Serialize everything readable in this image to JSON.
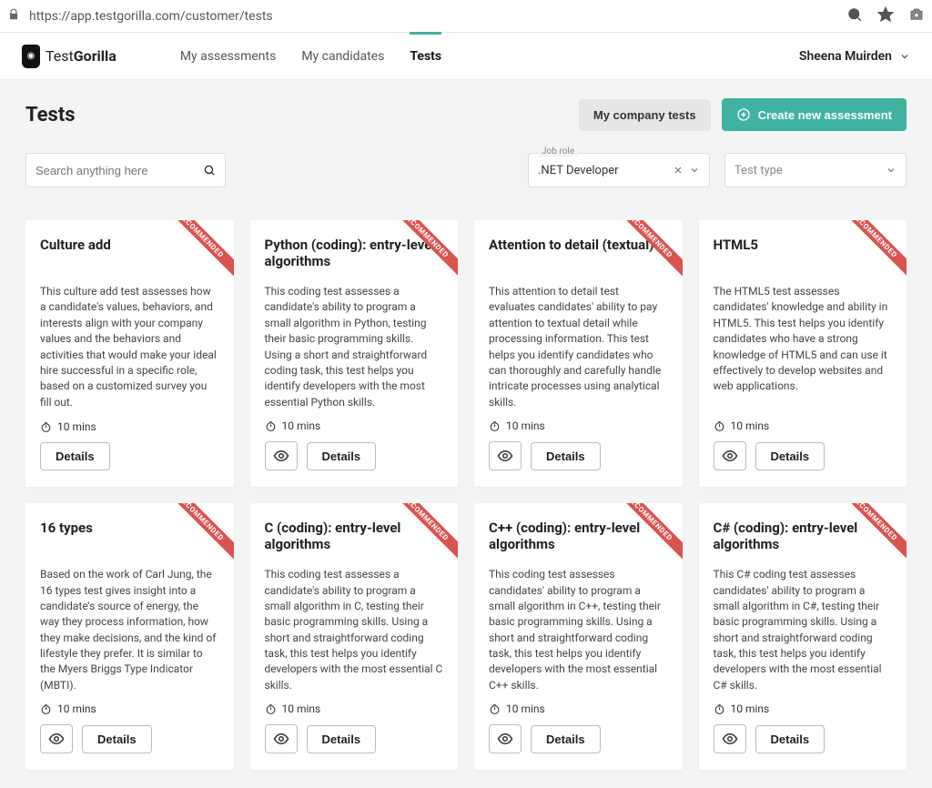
{
  "browser": {
    "url": "https://app.testgorilla.com/customer/tests"
  },
  "header": {
    "brand_prefix": "Test",
    "brand_bold": "Gorilla",
    "nav": [
      {
        "label": "My assessments"
      },
      {
        "label": "My candidates"
      },
      {
        "label": "Tests"
      }
    ],
    "active_nav_index": 2,
    "user_name": "Sheena Muirden"
  },
  "page": {
    "title": "Tests",
    "my_company_tests": "My company tests",
    "create_button": "Create new assessment"
  },
  "filters": {
    "search_placeholder": "Search anything here",
    "job_role_label": "Job role",
    "job_role_value": ".NET Developer",
    "test_type_placeholder": "Test type"
  },
  "common": {
    "details_label": "Details",
    "recommended_label": "RECOMMENDED"
  },
  "cards": [
    {
      "title": "Culture add",
      "desc": "This culture add test assesses how a candidate's values, behaviors, and interests align with your company values and the behaviors and activities that would make your ideal hire successful in a specific role, based on a customized survey you fill out.",
      "duration": "10 mins",
      "recommended": true,
      "has_preview": false
    },
    {
      "title": "Python (coding): entry-level algorithms",
      "desc": "This coding test assesses a candidate's ability to program a small algorithm in Python, testing their basic programming skills. Using a short and straightforward coding task, this test helps you identify developers with the most essential Python skills.",
      "duration": "10 mins",
      "recommended": true,
      "has_preview": true
    },
    {
      "title": "Attention to detail (textual)",
      "desc": "This attention to detail test evaluates candidates' ability to pay attention to textual detail while processing information. This test helps you identify candidates who can thoroughly and carefully handle intricate processes using analytical skills.",
      "duration": "10 mins",
      "recommended": true,
      "has_preview": true
    },
    {
      "title": "HTML5",
      "desc": "The HTML5 test assesses candidates' knowledge and ability in HTML5. This test helps you identify candidates who have a strong knowledge of HTML5 and can use it effectively to develop websites and web applications.",
      "duration": "10 mins",
      "recommended": true,
      "has_preview": true
    },
    {
      "title": "16 types",
      "desc": "Based on the work of Carl Jung, the 16 types test gives insight into a candidate's source of energy, the way they process information, how they make decisions, and the kind of lifestyle they prefer. It is similar to the Myers Briggs Type Indicator (MBTI).",
      "duration": "10 mins",
      "recommended": true,
      "has_preview": true
    },
    {
      "title": "C (coding): entry-level algorithms",
      "desc": "This coding test assesses a candidate's ability to program a small algorithm in C, testing their basic programming skills. Using a short and straightforward coding task, this test helps you identify developers with the most essential C skills.",
      "duration": "10 mins",
      "recommended": true,
      "has_preview": true
    },
    {
      "title": "C++ (coding): entry-level algorithms",
      "desc": "This coding test assesses candidates' ability to program a small algorithm in C++, testing their basic programming skills. Using a short and straightforward coding task, this test helps you identify developers with the most essential C++ skills.",
      "duration": "10 mins",
      "recommended": true,
      "has_preview": true
    },
    {
      "title": "C# (coding): entry-level algorithms",
      "desc": "This C# coding test assesses candidates' ability to program a small algorithm in C#, testing their basic programming skills. Using a short and straightforward coding task, this test helps you identify developers with the most essential C# skills.",
      "duration": "10 mins",
      "recommended": true,
      "has_preview": true
    }
  ]
}
